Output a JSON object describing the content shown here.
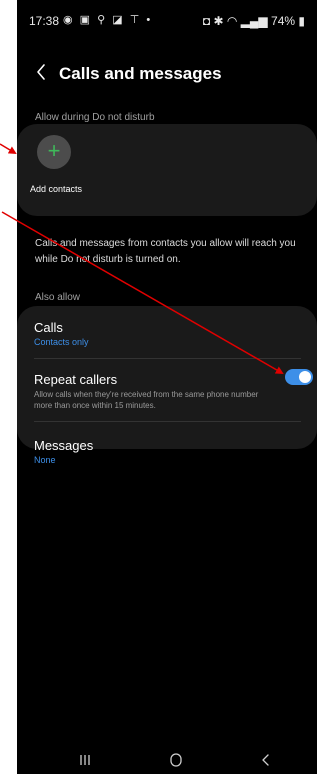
{
  "status_bar": {
    "time": "17:38",
    "left_icons": [
      "messenger-icon",
      "gallery-icon",
      "usb-icon",
      "image-icon",
      "antenna-icon",
      "dot-icon"
    ],
    "right_icons": [
      "battery-saver-icon",
      "bluetooth-icon",
      "wifi-icon",
      "signal-icon"
    ],
    "battery": "74%"
  },
  "header": {
    "title": "Calls and messages"
  },
  "dnd": {
    "section_label": "Allow during Do not disturb",
    "add_contacts_label": "Add contacts",
    "info_text": "Calls and messages from contacts you allow will reach you while Do not disturb is turned on."
  },
  "also_allow": {
    "section_label": "Also allow",
    "calls": {
      "title": "Calls",
      "value": "Contacts only"
    },
    "repeat_callers": {
      "title": "Repeat callers",
      "description": "Allow calls when they're received from the same phone number more than once within 15 minutes.",
      "enabled": true
    },
    "messages": {
      "title": "Messages",
      "value": "None"
    }
  },
  "nav": {
    "recents_icon": "recents-icon",
    "home_icon": "home-icon",
    "back_icon": "back-icon"
  },
  "colors": {
    "accent": "#3d8fe8",
    "card": "#1a1a1a",
    "background": "#000000",
    "add_plus": "#3fb95a",
    "annotation_arrow": "#e00000"
  }
}
